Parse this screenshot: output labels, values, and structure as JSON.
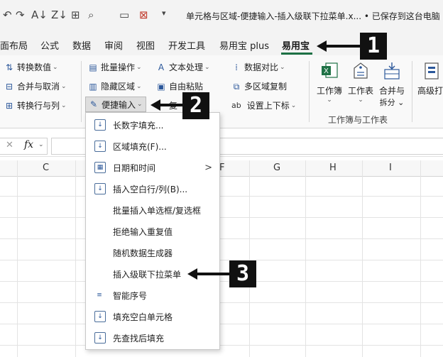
{
  "titlebar": {
    "doc_title": "单元格与区域-便捷输入-插入级联下拉菜单.x... • 已保存到这台电脑"
  },
  "tabs": [
    {
      "label": "面布局",
      "active": false
    },
    {
      "label": "公式",
      "active": false
    },
    {
      "label": "数据",
      "active": false
    },
    {
      "label": "审阅",
      "active": false
    },
    {
      "label": "视图",
      "active": false
    },
    {
      "label": "开发工具",
      "active": false
    },
    {
      "label": "易用宝 plus",
      "active": false
    },
    {
      "label": "易用宝",
      "active": true
    }
  ],
  "ribbon": {
    "col1": [
      "转换数值",
      "合并与取消",
      "转换行与列"
    ],
    "col2": [
      "批量操作",
      "隐藏区域",
      "便捷输入"
    ],
    "col3": [
      "文本处理",
      "自由粘贴",
      "复"
    ],
    "col4": [
      "数据对比",
      "多区域复制",
      "设置上下标"
    ],
    "col4_extra": "ab",
    "big_buttons": [
      {
        "label": "工作簿",
        "sub": "⌄"
      },
      {
        "label": "工作表",
        "sub": "⌄"
      },
      {
        "label": "合并与",
        "sub": "拆分 ⌄"
      },
      {
        "label": "高级打",
        "sub": ""
      }
    ],
    "group_label": "工作簿与工作表"
  },
  "formula_bar": {
    "fx": "fx"
  },
  "columns": [
    "C",
    "F",
    "G",
    "H",
    "I"
  ],
  "menu": {
    "items": [
      {
        "label": "长数字填充...",
        "icon": "↓",
        "submenu": false
      },
      {
        "label": "区域填充(F)...",
        "icon": "↓",
        "submenu": false
      },
      {
        "label": "日期和时间",
        "icon": "▦",
        "submenu": true
      },
      {
        "label": "插入空白行/列(B)...",
        "icon": "↓",
        "submenu": false
      },
      {
        "label": "批量插入单选框/复选框",
        "icon": "",
        "submenu": false
      },
      {
        "label": "拒绝输入重复值",
        "icon": "",
        "submenu": false
      },
      {
        "label": "随机数据生成器",
        "icon": "",
        "submenu": false
      },
      {
        "label": "插入级联下拉菜单",
        "icon": "",
        "submenu": false
      },
      {
        "label": "智能序号",
        "icon": "≡",
        "submenu": false
      },
      {
        "label": "填充空白单元格",
        "icon": "↓",
        "submenu": false
      },
      {
        "label": "先查找后填充",
        "icon": "↓",
        "submenu": false
      }
    ],
    "submenu_arrow": ">"
  },
  "callouts": [
    "1",
    "2",
    "3"
  ]
}
